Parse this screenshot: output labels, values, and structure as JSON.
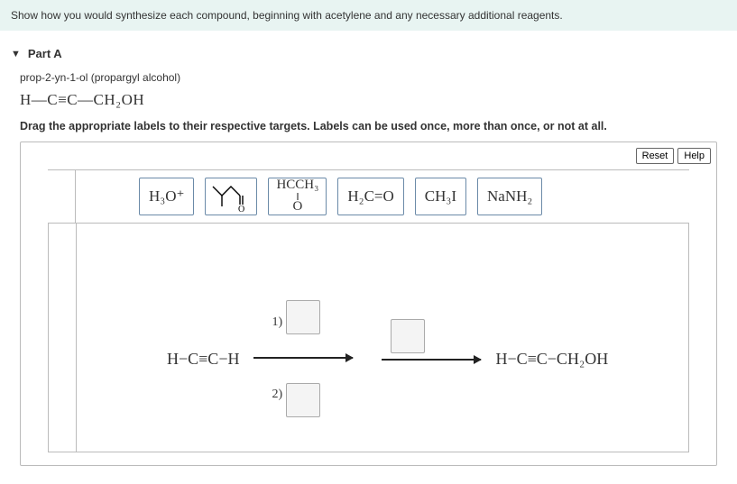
{
  "prompt": "Show how you would synthesize each compound, beginning with acetylene and any necessary additional reagents.",
  "part": {
    "label": "Part A"
  },
  "compound_name": "prop-2-yn-1-ol (propargyl alcohol)",
  "compound_formula": "H—C≡C—CH₂OH",
  "instruction": "Drag the appropriate labels to their respective targets. Labels can be used once, more than once, or not at all.",
  "buttons": {
    "reset": "Reset",
    "help": "Help"
  },
  "palette": {
    "h3o": "H₃O⁺",
    "carbonyl_skeletal": "isobutyraldehyde-skeletal",
    "hcch3_over_o": {
      "top": "HCCH₃",
      "mid": "‖",
      "bot": "O"
    },
    "h2co": "H₂C=O",
    "ch3i": "CH₃I",
    "nanh2": "NaNH₂"
  },
  "scheme": {
    "start": "H−C≡C−H",
    "step1_num1": "1)",
    "step1_num2": "2)",
    "product": "H−C≡C−CH₂OH"
  }
}
